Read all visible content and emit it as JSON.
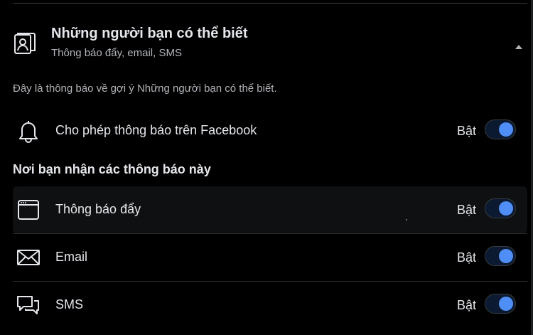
{
  "header": {
    "title": "Những người bạn có thể biết",
    "subtitle": "Thông báo đẩy, email, SMS",
    "icon": "friend-suggestion-icon",
    "collapse_icon": "caret-up-icon"
  },
  "description": "Đây là thông báo về gợi ý Những người bạn có thể biết.",
  "allow_row": {
    "label": "Cho phép thông báo trên Facebook",
    "status": "Bật",
    "icon": "bell-icon",
    "enabled": true
  },
  "section_title": "Nơi bạn nhận các thông báo này",
  "channels": [
    {
      "label": "Thông báo đẩy",
      "status": "Bật",
      "icon": "browser-window-icon",
      "enabled": true
    },
    {
      "label": "Email",
      "status": "Bật",
      "icon": "envelope-icon",
      "enabled": true
    },
    {
      "label": "SMS",
      "status": "Bật",
      "icon": "chat-bubbles-icon",
      "enabled": true
    }
  ],
  "colors": {
    "background": "#000000",
    "text_primary": "#e4e6eb",
    "text_secondary": "#b0b3b8",
    "toggle_on": "#4f8ef7"
  }
}
